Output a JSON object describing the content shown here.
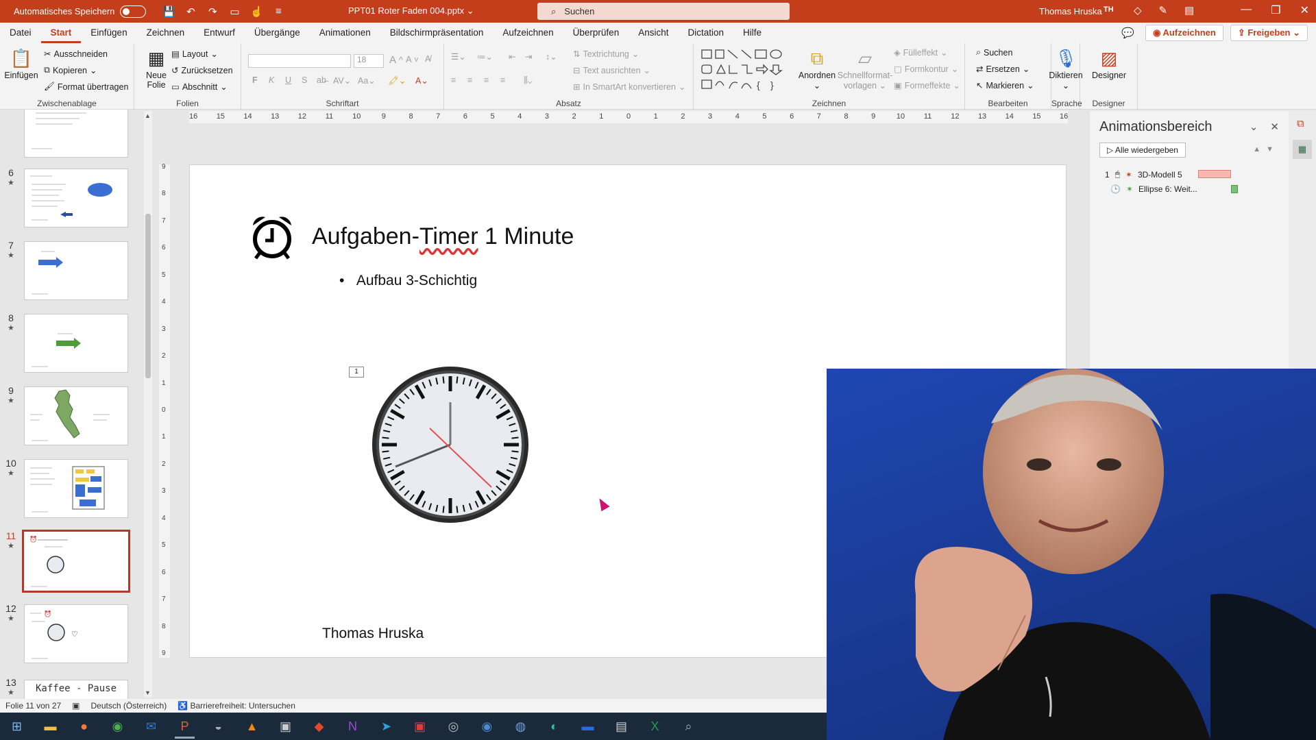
{
  "titlebar": {
    "autosave_label": "Automatisches Speichern",
    "file_name": "PPT01 Roter Faden 004.pptx",
    "search_placeholder": "Suchen",
    "user_name": "Thomas Hruska",
    "user_initials": "TH"
  },
  "menu": {
    "tabs": [
      "Datei",
      "Start",
      "Einfügen",
      "Zeichnen",
      "Entwurf",
      "Übergänge",
      "Animationen",
      "Bildschirmpräsentation",
      "Aufzeichnen",
      "Überprüfen",
      "Ansicht",
      "Dictation",
      "Hilfe"
    ],
    "record_label": "Aufzeichnen",
    "share_label": "Freigeben"
  },
  "ribbon": {
    "clipboard": {
      "paste": "Einfügen",
      "cut": "Ausschneiden",
      "copy": "Kopieren",
      "format_painter": "Format übertragen",
      "label": "Zwischenablage"
    },
    "slides": {
      "new_slide_line1": "Neue",
      "new_slide_line2": "Folie",
      "layout": "Layout",
      "reset": "Zurücksetzen",
      "section": "Abschnitt",
      "label": "Folien"
    },
    "font": {
      "size": "18",
      "bold": "F",
      "italic": "K",
      "underline": "U",
      "strike": "S",
      "label": "Schriftart"
    },
    "paragraph": {
      "text_direction": "Textrichtung",
      "align_text": "Text ausrichten",
      "smartart": "In SmartArt konvertieren",
      "label": "Absatz"
    },
    "drawing": {
      "arrange": "Anordnen",
      "quick_styles_line1": "Schnellformat-",
      "quick_styles_line2": "vorlagen",
      "fill": "Fülleffekt",
      "outline": "Formkontur",
      "effects": "Formeffekte",
      "label": "Zeichnen"
    },
    "editing": {
      "find": "Suchen",
      "replace": "Ersetzen",
      "select": "Markieren",
      "label": "Bearbeiten"
    },
    "voice": {
      "dictate": "Diktieren",
      "label": "Sprache"
    },
    "designer": {
      "button": "Designer",
      "label": "Designer"
    }
  },
  "thumbnails": [
    {
      "num": "6",
      "star": "★"
    },
    {
      "num": "7",
      "star": "★"
    },
    {
      "num": "8",
      "star": "★"
    },
    {
      "num": "9",
      "star": "★"
    },
    {
      "num": "10",
      "star": "★"
    },
    {
      "num": "11",
      "star": "★"
    },
    {
      "num": "12",
      "star": "★"
    },
    {
      "num": "13",
      "star": "★",
      "preview_text": "Kaffee - Pause"
    }
  ],
  "ruler": {
    "h_ticks": [
      "16",
      "15",
      "14",
      "13",
      "12",
      "11",
      "10",
      "9",
      "8",
      "7",
      "6",
      "5",
      "4",
      "3",
      "2",
      "1",
      "0",
      "1",
      "2",
      "3",
      "4",
      "5",
      "6",
      "7",
      "8",
      "9",
      "10",
      "11",
      "12",
      "13",
      "14",
      "15",
      "16"
    ],
    "v_ticks": [
      "9",
      "8",
      "7",
      "6",
      "5",
      "4",
      "3",
      "2",
      "1",
      "0",
      "1",
      "2",
      "3",
      "4",
      "5",
      "6",
      "7",
      "8",
      "9"
    ]
  },
  "slide": {
    "title_before": "Aufgaben-",
    "title_underlined": "Timer",
    "title_after": " 1 Minute",
    "bullet": "Aufbau 3-Schichtig",
    "author": "Thomas Hruska",
    "anim_tag": "1"
  },
  "animation_pane": {
    "title": "Animationsbereich",
    "play_all": "Alle wiedergeben",
    "items": [
      {
        "order": "1",
        "name": "3D-Modell 5",
        "bar_color": "#f6b8b0"
      },
      {
        "order": "",
        "name": "Ellipse 6: Weit...",
        "bar_color": "#7cbf7a"
      }
    ]
  },
  "status": {
    "slide_info": "Folie 11 von 27",
    "language": "Deutsch (Österreich)",
    "accessibility": "Barrierefreiheit: Untersuchen"
  },
  "colors": {
    "accent": "#c43e1c",
    "clock_hand_red": "#e05050"
  }
}
